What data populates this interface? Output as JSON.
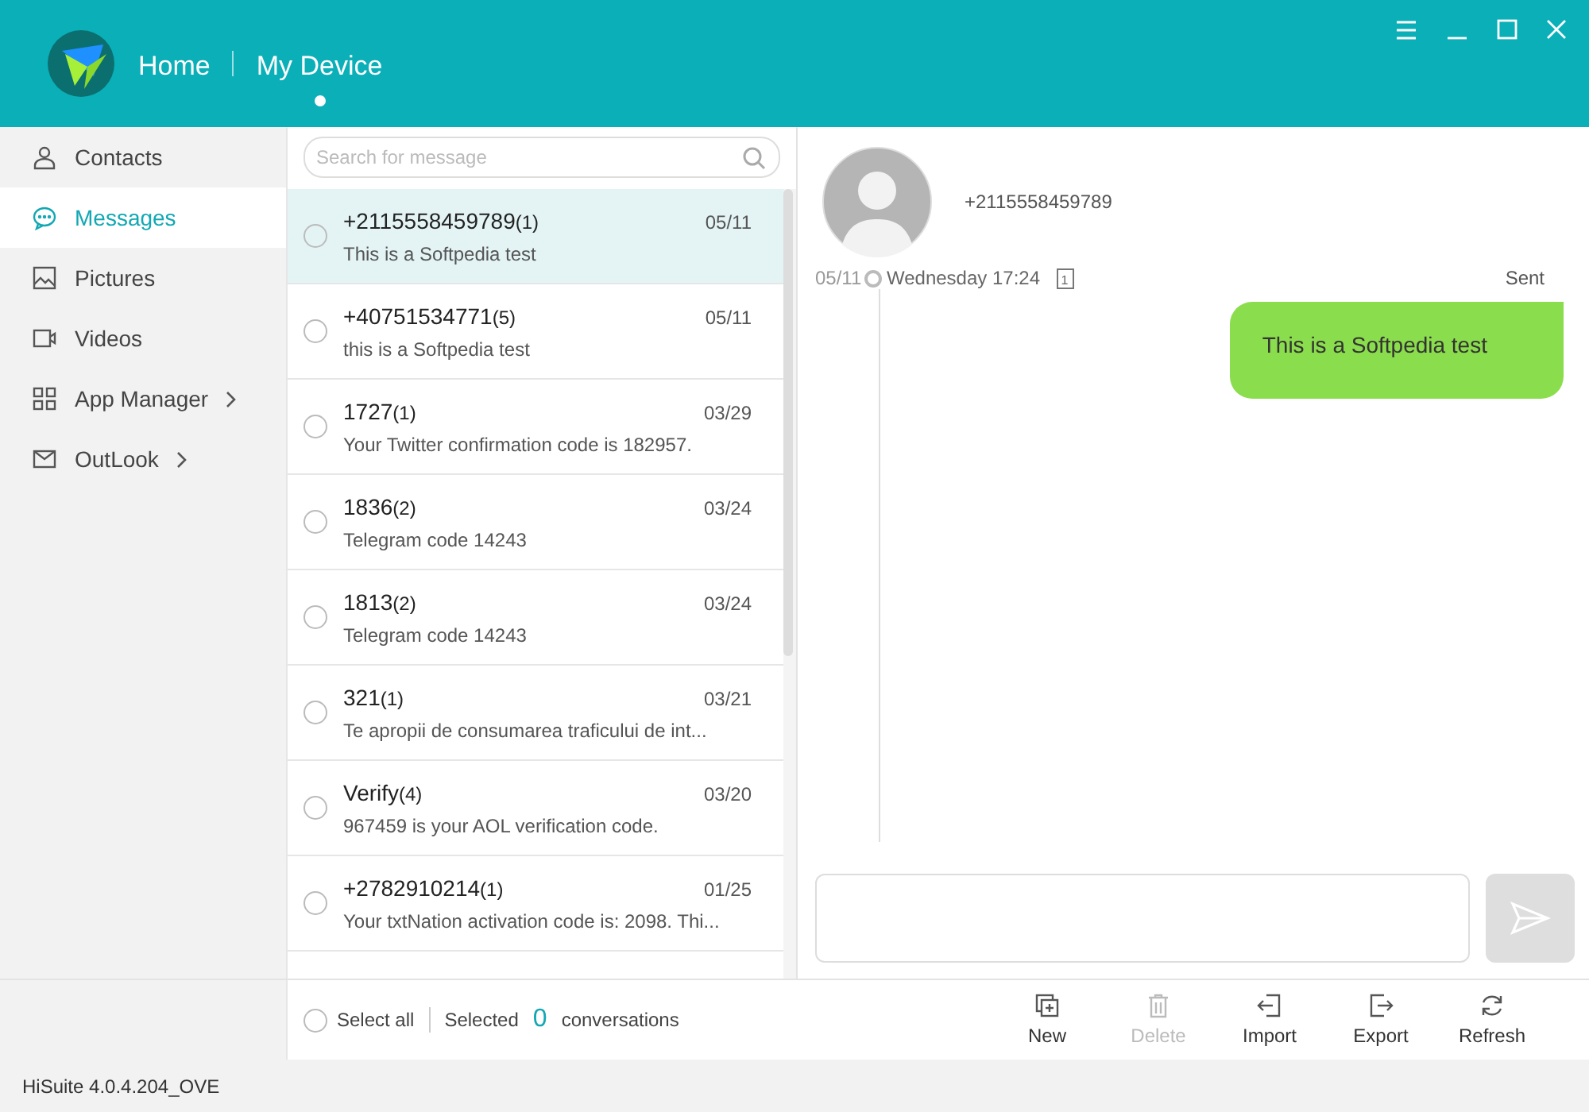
{
  "header": {
    "nav": [
      {
        "label": "Home",
        "selected": false
      },
      {
        "label": "My Device",
        "selected": true
      }
    ]
  },
  "sidebar": {
    "items": [
      {
        "label": "Contacts",
        "selected": false,
        "expandable": false
      },
      {
        "label": "Messages",
        "selected": true,
        "expandable": false
      },
      {
        "label": "Pictures",
        "selected": false,
        "expandable": false
      },
      {
        "label": "Videos",
        "selected": false,
        "expandable": false
      },
      {
        "label": "App Manager",
        "selected": false,
        "expandable": true
      },
      {
        "label": "OutLook",
        "selected": false,
        "expandable": true
      }
    ]
  },
  "search": {
    "placeholder": "Search for message"
  },
  "conversations": [
    {
      "name": "+2115558459789",
      "count": "(1)",
      "date": "05/11",
      "preview": "This is a Softpedia test",
      "selected": true,
      "checked": false
    },
    {
      "name": "+40751534771",
      "count": "(5)",
      "date": "05/11",
      "preview": "this is a Softpedia test",
      "selected": false,
      "checked": false
    },
    {
      "name": "1727",
      "count": "(1)",
      "date": "03/29",
      "preview": "Your Twitter confirmation code is 182957.",
      "selected": false,
      "checked": false
    },
    {
      "name": "1836",
      "count": "(2)",
      "date": "03/24",
      "preview": "Telegram code 14243",
      "selected": false,
      "checked": false
    },
    {
      "name": "1813",
      "count": "(2)",
      "date": "03/24",
      "preview": "Telegram code 14243",
      "selected": false,
      "checked": false
    },
    {
      "name": "321",
      "count": "(1)",
      "date": "03/21",
      "preview": "Te apropii de consumarea traficului de int...",
      "selected": false,
      "checked": false
    },
    {
      "name": "Verify",
      "count": "(4)",
      "date": "03/20",
      "preview": "967459 is your AOL verification code.",
      "selected": false,
      "checked": false
    },
    {
      "name": "+2782910214",
      "count": "(1)",
      "date": "01/25",
      "preview": "Your txtNation activation code is: 2098. Thi...",
      "selected": false,
      "checked": false
    }
  ],
  "list_footer": {
    "select_all": {
      "label": "Select all",
      "checked": false
    },
    "selected_label": "Selected",
    "selected_count": "0",
    "conversations_label": "conversations"
  },
  "chat": {
    "contact": "+2115558459789",
    "date": "05/11",
    "time": "Wednesday 17:24",
    "sim": "1",
    "status": "Sent",
    "messages": [
      {
        "text": "This is a Softpedia test"
      }
    ]
  },
  "toolbar": [
    {
      "label": "New",
      "disabled": false
    },
    {
      "label": "Delete",
      "disabled": true
    },
    {
      "label": "Import",
      "disabled": false
    },
    {
      "label": "Export",
      "disabled": false
    },
    {
      "label": "Refresh",
      "disabled": false
    }
  ],
  "status_bar": "HiSuite 4.0.4.204_OVE"
}
